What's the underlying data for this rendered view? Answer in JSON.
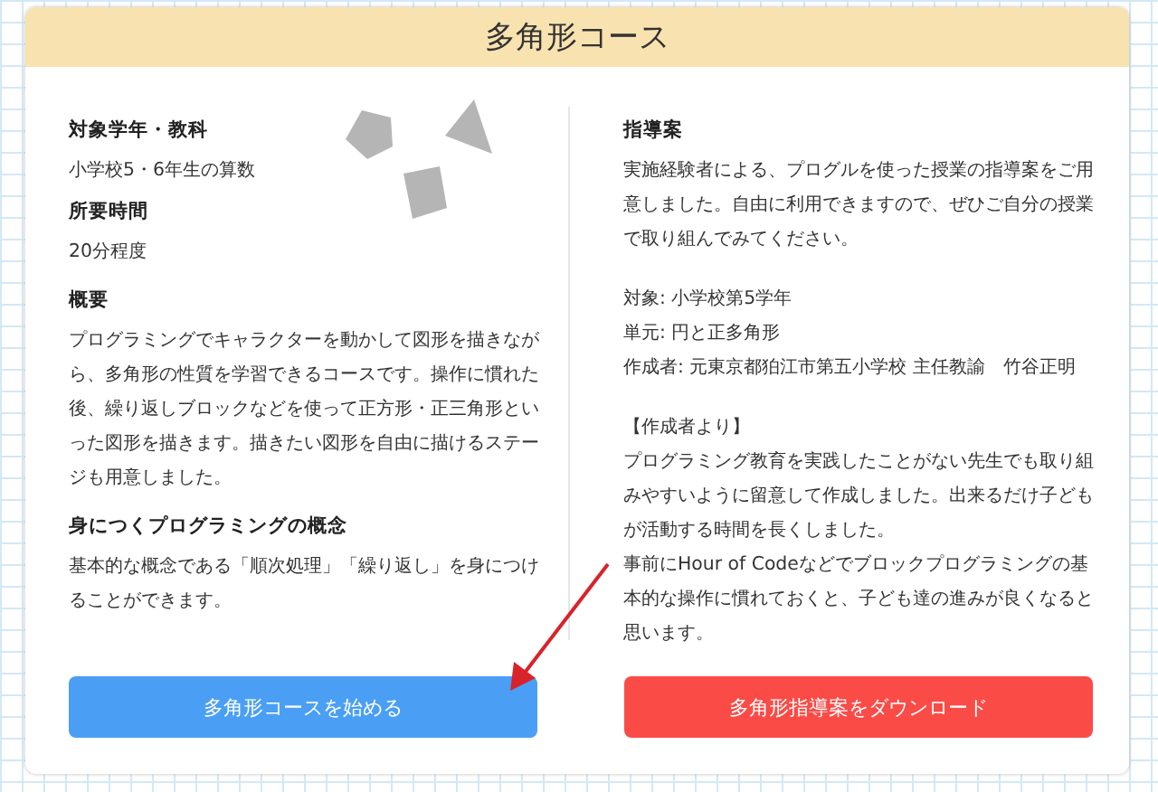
{
  "title": "多角形コース",
  "overview": {
    "top_sections": [
      {
        "heading": "対象学年・教科",
        "body": "小学校5・6年生の算数"
      },
      {
        "heading": "所要時間",
        "body": "20分程度"
      }
    ],
    "sections": [
      {
        "heading": "概要",
        "body": "プログラミングでキャラクターを動かして図形を描きながら、多角形の性質を学習できるコースです。操作に慣れた後、繰り返しブロックなどを使って正方形・正三角形といった図形を描きます。描きたい図形を自由に描けるステージも用意しました。"
      },
      {
        "heading": "身につくプログラミングの概念",
        "body": "基本的な概念である「順次処理」「繰り返し」を身につけることができます。"
      }
    ]
  },
  "guide": {
    "heading": "指導案",
    "blocks": [
      [
        "実施経験者による、プログルを使った授業の指導案をご用意しました。自由に利用できますので、ぜひご自分の授業で取り組んでみてください。"
      ],
      [
        "対象: 小学校第5学年",
        "単元: 円と正多角形",
        "作成者: 元東京都狛江市第五小学校 主任教諭　竹谷正明"
      ],
      [
        "【作成者より】",
        "プログラミング教育を実践したことがない先生でも取り組みやすいように留意して作成しました。出来るだけ子どもが活動する時間を長くしました。",
        "事前にHour of Codeなどでブロックプログラミングの基本的な操作に慣れておくと、子ども達の進みが良くなると思います。"
      ]
    ]
  },
  "buttons": [
    {
      "label": "多角形コースを始める",
      "kind": "start"
    },
    {
      "label": "多角形指導案をダウンロード",
      "kind": "download"
    }
  ]
}
